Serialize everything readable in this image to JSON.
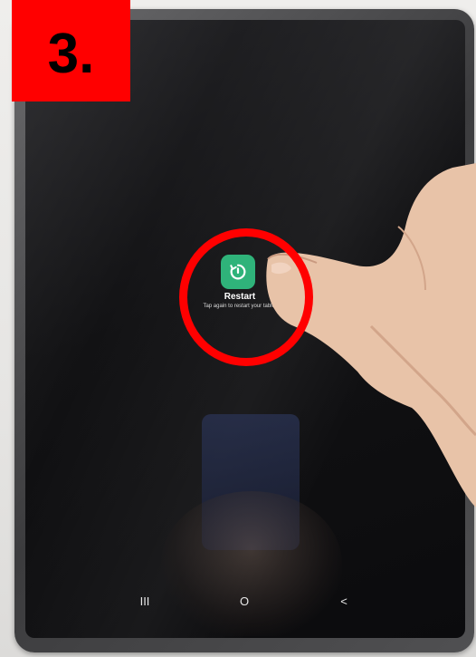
{
  "step_label": "3.",
  "screen": {
    "restart_button": {
      "icon": "restart-icon",
      "color": "#2fb37a",
      "label": "Restart",
      "hint": "Tap again to restart your tablet"
    },
    "highlight_color": "#ff0000",
    "nav_bar": {
      "recents": "III",
      "home": "O",
      "back": "<"
    }
  }
}
